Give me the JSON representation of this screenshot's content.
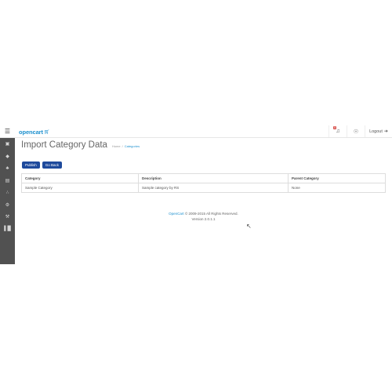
{
  "header": {
    "logo_text": "opencart",
    "bell_badge": "0",
    "logout_label": "Logout"
  },
  "sidebar": {
    "items": [
      {
        "icon": "dashboard-icon",
        "glyph": "⌸"
      },
      {
        "icon": "tag-icon",
        "glyph": "◆"
      },
      {
        "icon": "puzzle-icon",
        "glyph": "☘"
      },
      {
        "icon": "cart-icon",
        "glyph": "⌁"
      },
      {
        "icon": "share-icon",
        "glyph": "∴"
      },
      {
        "icon": "gear-icon",
        "glyph": "⚙"
      },
      {
        "icon": "wrench-icon",
        "glyph": "⚒"
      },
      {
        "icon": "chart-icon",
        "glyph": "▓"
      }
    ]
  },
  "page": {
    "title": "Import Category Data",
    "breadcrumb": {
      "home": "Home",
      "separator": "/",
      "current": "Categories"
    }
  },
  "buttons": {
    "publish": "Publish",
    "go_back": "Go Back"
  },
  "table": {
    "headers": [
      "Category",
      "Description",
      "Parent Category"
    ],
    "rows": [
      [
        "Sample Category",
        "Sample category by RS",
        "None"
      ]
    ]
  },
  "footer": {
    "brand": "OpenCart",
    "copyright": "© 2009-2015 All Rights Reserved.",
    "version": "Version 2.0.1.1"
  }
}
